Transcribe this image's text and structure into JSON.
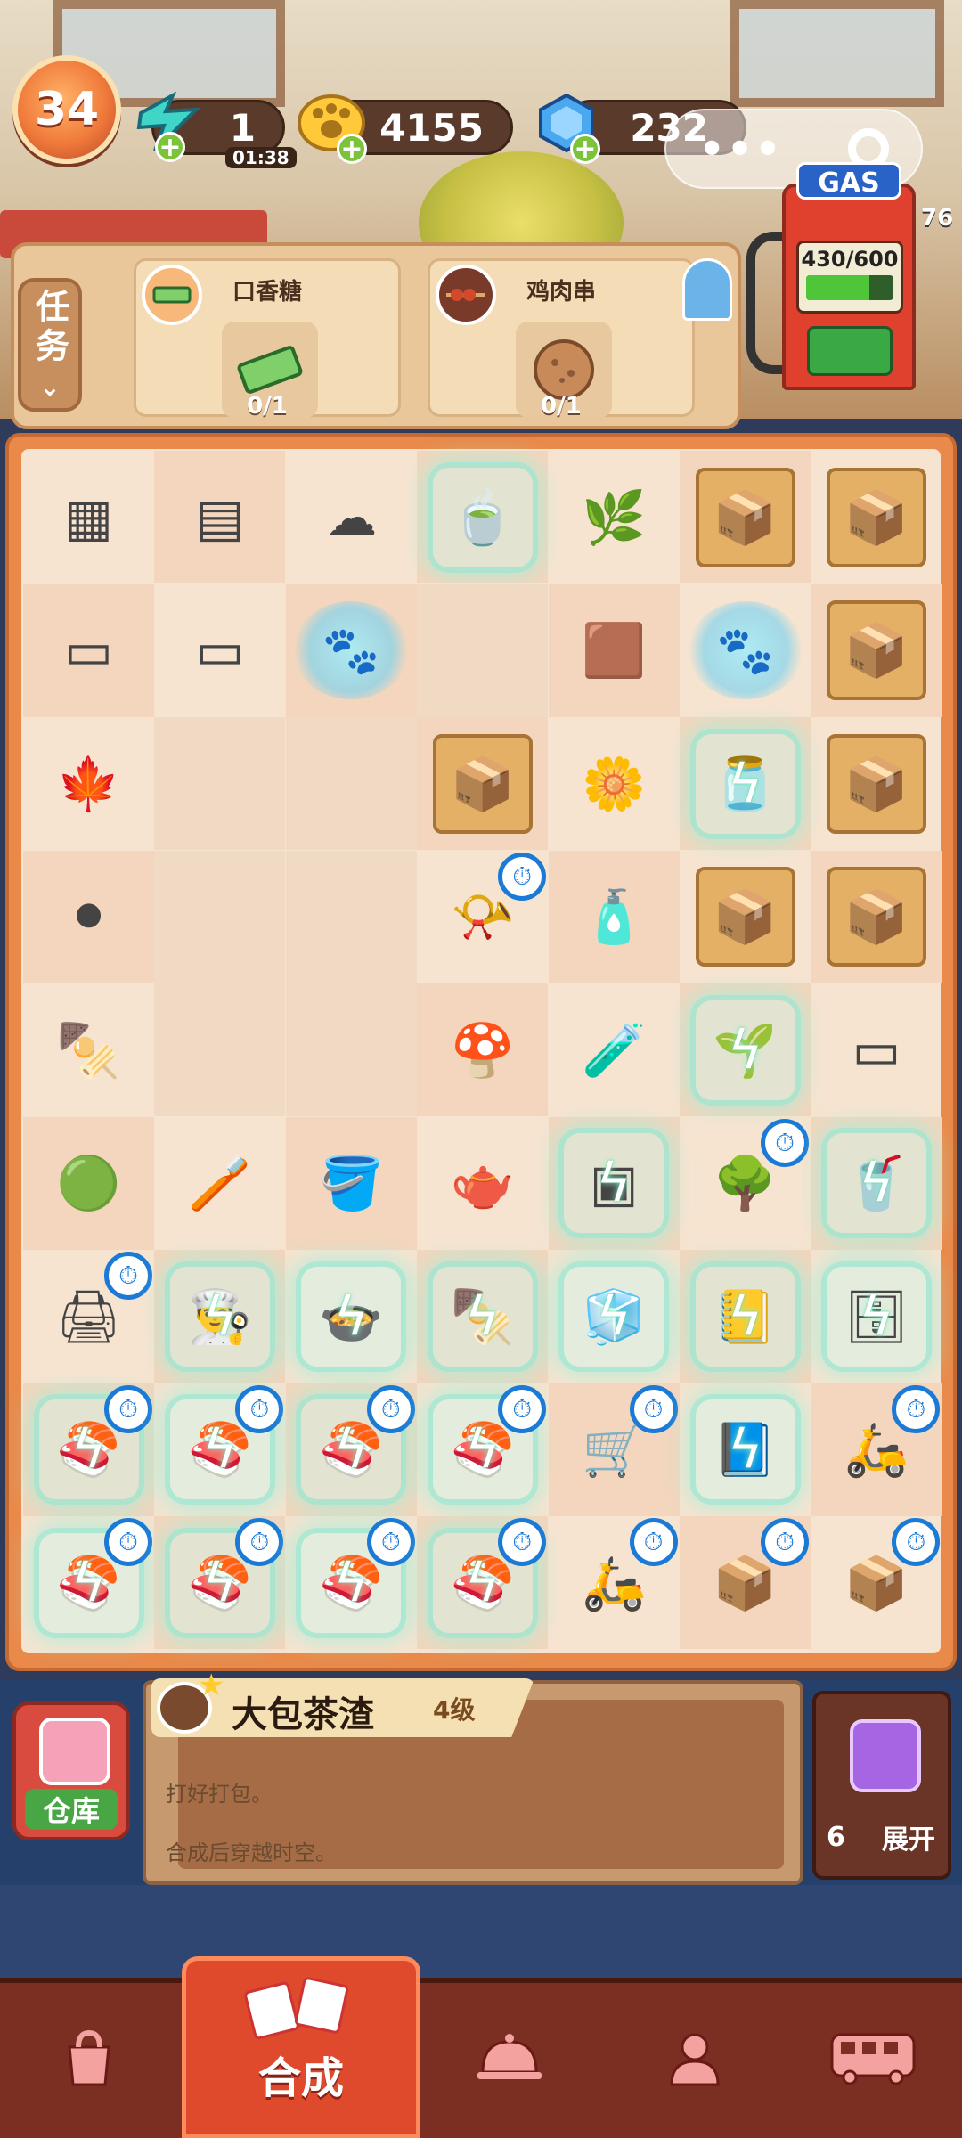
{
  "top": {
    "level": "34",
    "energy": {
      "value": "1",
      "timer": "01:38"
    },
    "coins": "4155",
    "gems": "232"
  },
  "task_bar": {
    "button_label": "任务",
    "tasks": [
      {
        "title": "口香糖",
        "progress": "0/1"
      },
      {
        "title": "鸡肉串",
        "progress": "0/1"
      }
    ]
  },
  "gas": {
    "label": "GAS",
    "capacity": "430/600",
    "fill_fraction": 0.72,
    "side_text": "76"
  },
  "board": {
    "rows": [
      [
        {
          "icon": "stone-tiles",
          "glyph": "▦"
        },
        {
          "icon": "metal-plates",
          "glyph": "▤"
        },
        {
          "icon": "cotton",
          "glyph": "☁"
        },
        {
          "icon": "tea-dish",
          "glyph": "🍵",
          "glow": true
        },
        {
          "icon": "herb-board",
          "glyph": "🌿"
        },
        {
          "icon": "takeout-box",
          "glyph": "📦",
          "box": true
        },
        {
          "icon": "takeout-box",
          "glyph": "📦",
          "box": true
        }
      ],
      [
        {
          "icon": "paper-stack",
          "glyph": "▭"
        },
        {
          "icon": "paper-roll",
          "glyph": "▭"
        },
        {
          "icon": "paw-cloud",
          "glyph": "🐾",
          "paw": true
        },
        {
          "icon": "empty",
          "empty": true
        },
        {
          "icon": "spilled-tea-bag",
          "glyph": "🟫"
        },
        {
          "icon": "paw-cloud",
          "glyph": "🐾",
          "paw": true
        },
        {
          "icon": "takeout-box",
          "glyph": "📦",
          "box": true
        }
      ],
      [
        {
          "icon": "maple-wreath",
          "glyph": "🍁"
        },
        {
          "icon": "empty",
          "empty": true
        },
        {
          "icon": "empty",
          "empty": true
        },
        {
          "icon": "takeout-box",
          "glyph": "📦",
          "box": true
        },
        {
          "icon": "flower",
          "glyph": "🌼"
        },
        {
          "icon": "fish-jar",
          "glyph": "🫙",
          "glow": true,
          "bolt": true
        },
        {
          "icon": "takeout-box",
          "glyph": "📦",
          "box": true
        }
      ],
      [
        {
          "icon": "tires",
          "glyph": "⚫"
        },
        {
          "icon": "empty",
          "empty": true
        },
        {
          "icon": "empty",
          "empty": true
        },
        {
          "icon": "star-tube",
          "glyph": "📯",
          "timer": true
        },
        {
          "icon": "bottle",
          "glyph": "🧴"
        },
        {
          "icon": "takeout-box",
          "glyph": "📦",
          "box": true
        },
        {
          "icon": "takeout-box",
          "glyph": "📦",
          "box": true
        }
      ],
      [
        {
          "icon": "skewer-cards",
          "glyph": "🍢"
        },
        {
          "icon": "empty",
          "empty": true
        },
        {
          "icon": "empty",
          "empty": true
        },
        {
          "icon": "mushroom",
          "glyph": "🍄"
        },
        {
          "icon": "bottles",
          "glyph": "🧪"
        },
        {
          "icon": "bonsai-sprout",
          "glyph": "🌱",
          "glow": true,
          "bolt": true
        },
        {
          "icon": "wall-shelf",
          "glyph": "▭"
        }
      ],
      [
        {
          "icon": "tape-measure",
          "glyph": "🟢"
        },
        {
          "icon": "brush",
          "glyph": "🪥"
        },
        {
          "icon": "bucket",
          "glyph": "🪣"
        },
        {
          "icon": "teapot",
          "glyph": "🫖"
        },
        {
          "icon": "safe",
          "glyph": "▣",
          "glow": true,
          "bolt": true
        },
        {
          "icon": "bonsai-tree",
          "glyph": "🌳",
          "timer": true
        },
        {
          "icon": "drink-shelf",
          "glyph": "🥤",
          "glow": true,
          "bolt": true
        }
      ],
      [
        {
          "icon": "printer",
          "glyph": "🖨",
          "timer": true
        },
        {
          "icon": "chef-hat",
          "glyph": "👨‍🍳",
          "glow": true,
          "bolt": true
        },
        {
          "icon": "hotpot",
          "glyph": "🍲",
          "glow": true,
          "bolt": true
        },
        {
          "icon": "skewer-cart",
          "glyph": "🍢",
          "glow": true,
          "bolt": true
        },
        {
          "icon": "fridge",
          "glyph": "🧊",
          "glow": true,
          "bolt": true
        },
        {
          "icon": "notebook",
          "glyph": "📒",
          "glow": true,
          "bolt": true
        },
        {
          "icon": "shelf-goods",
          "glyph": "🗄",
          "glow": true,
          "bolt": true
        }
      ],
      [
        {
          "icon": "sushi-roll",
          "glyph": "🍣",
          "glow": true,
          "bolt": true,
          "timer": true
        },
        {
          "icon": "sushi-roll",
          "glyph": "🍣",
          "glow": true,
          "bolt": true,
          "timer": true
        },
        {
          "icon": "sushi-roll",
          "glyph": "🍣",
          "glow": true,
          "bolt": true,
          "timer": true
        },
        {
          "icon": "sushi-roll",
          "glyph": "🍣",
          "glow": true,
          "bolt": true,
          "timer": true
        },
        {
          "icon": "hand-truck",
          "glyph": "🛒",
          "timer": true
        },
        {
          "icon": "ledger",
          "glyph": "📘",
          "glow": true,
          "bolt": true
        },
        {
          "icon": "delivery-bike",
          "glyph": "🛵",
          "timer": true
        }
      ],
      [
        {
          "icon": "sushi-roll",
          "glyph": "🍣",
          "glow": true,
          "bolt": true,
          "timer": true
        },
        {
          "icon": "sushi-roll",
          "glyph": "🍣",
          "glow": true,
          "bolt": true,
          "timer": true
        },
        {
          "icon": "sushi-roll",
          "glyph": "🍣",
          "glow": true,
          "bolt": true,
          "timer": true
        },
        {
          "icon": "sushi-roll",
          "glyph": "🍣",
          "glow": true,
          "bolt": true,
          "timer": true
        },
        {
          "icon": "scooter",
          "glyph": "🛵",
          "timer": true
        },
        {
          "icon": "drone-box",
          "glyph": "📦",
          "timer": true
        },
        {
          "icon": "drone-box",
          "glyph": "📦",
          "timer": true
        }
      ]
    ]
  },
  "info": {
    "storage_label": "仓库",
    "item_name": "大包茶渣",
    "item_level": "4级",
    "desc_lines": [
      "打好打包。",
      "合成后穿越时空。"
    ],
    "expand_count": "6",
    "expand_label": "展开"
  },
  "nav": {
    "items": [
      {
        "name": "shop",
        "icon": "bag-icon"
      },
      {
        "name": "merge",
        "label": "合成",
        "active": true
      },
      {
        "name": "serve",
        "icon": "cloche-icon"
      },
      {
        "name": "chef",
        "icon": "chef-icon"
      },
      {
        "name": "bus",
        "icon": "bus-icon"
      }
    ]
  }
}
